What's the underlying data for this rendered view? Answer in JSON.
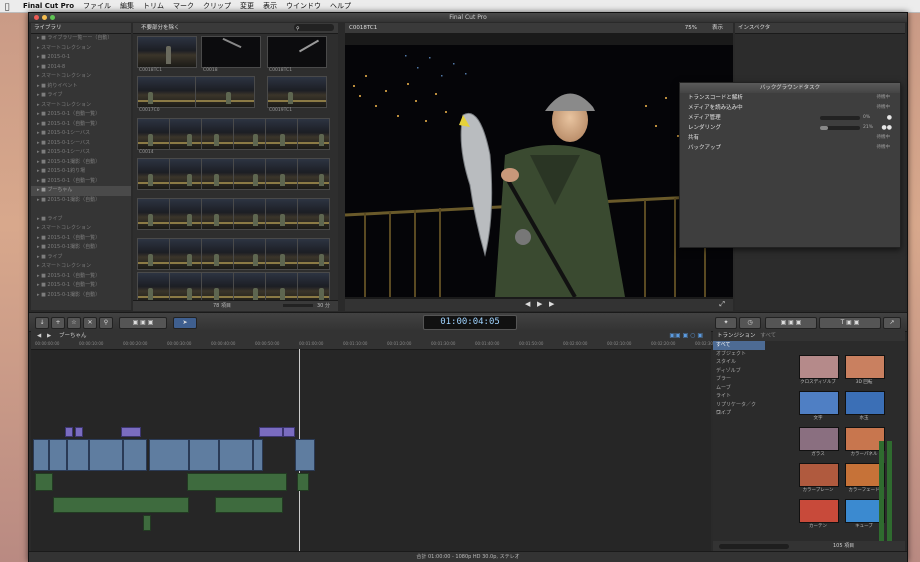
{
  "menubar": {
    "apple": "",
    "app": "Final Cut Pro",
    "items": [
      "ファイル",
      "編集",
      "トリム",
      "マーク",
      "クリップ",
      "変更",
      "表示",
      "ウインドウ",
      "ヘルプ"
    ]
  },
  "window": {
    "title": "Final Cut Pro"
  },
  "library": {
    "header": "ライブラリ",
    "rows": [
      "▸ ■ ライブラリ一覧ーー（自動）",
      "  ▸ スマートコレクション",
      "  ▸ ■ 2015-0-1",
      "  ▸ ■ 2014-8",
      "  ▸ スマートコレクション",
      "  ▸ ■ 釣りイベント",
      "▸ ■ ライブ",
      "  ▸ スマートコレクション",
      "  ▸ ■ 2015-0-1（自動一覧）",
      "  ▸ ■ 2015-0-1（自動一覧）",
      "  ▸ ■ 2015-0-1シーバス",
      "  ▸ ■ 2015-0-1シーバス",
      "  ▸ ■ 2015-0-1シーバス",
      "  ▸ ■ 2015-0-1撮影（自動）",
      "  ▸ ■ 2015-0-1釣り場",
      "  ▸ ■ 2015-0-1（自動一覧）",
      "  ▸ ■ ブーちゃん",
      "  ▸ ■ 2015-0-1撮影（自動）",
      "",
      "▸ ■ ライブ",
      "  ▸ スマートコレクション",
      "  ▸ ■ 2015-0-1（自動一覧）",
      "  ▸ ■ 2015-0-1撮影（自動）",
      "▸ ■ ライブ",
      "  ▸ スマートコレクション",
      "  ▸ ■ 2015-0-1（自動一覧）",
      "  ▸ ■ 2015-0-1（自動一覧）",
      "  ▸ ■ 2015-0-1撮影（自動）"
    ]
  },
  "browser": {
    "filter": "不要部分を除く",
    "captions": [
      "C0018TC1",
      "C0018",
      "C0018TC1",
      "C0017C0",
      "C0019TC1",
      "C0014"
    ],
    "footer_count": "78 項目",
    "footer_duration": "30 分"
  },
  "viewer": {
    "clip_name": "C0018TC1",
    "zoom": "75%",
    "view_label": "表示"
  },
  "inspector": {
    "header": "インスペクタ"
  },
  "background_tasks": {
    "title": "バックグラウンドタスク",
    "items": [
      {
        "label": "トランスコードと解析",
        "status": "待機中"
      },
      {
        "label": "メディアを読み込み中",
        "status": "待機中"
      },
      {
        "label": "メディア管理",
        "pct": "0%"
      },
      {
        "label": "レンダリング",
        "pct": "21%"
      },
      {
        "label": "共有",
        "status": "待機中"
      },
      {
        "label": "バックアップ",
        "status": "待機中"
      }
    ],
    "render_progress": 0.21,
    "media_progress": 0.0
  },
  "toolbar": {
    "timecode": "01:00:04:05",
    "project": "ブーちゃん"
  },
  "timeline": {
    "ruler": [
      "00:00:00:00",
      "00:00:10:00",
      "00:00:20:00",
      "00:00:30:00",
      "00:00:40:00",
      "00:00:50:00",
      "00:01:00:00",
      "00:01:10:00",
      "00:01:20:00",
      "00:01:30:00",
      "00:01:40:00",
      "00:01:50:00",
      "00:02:00:00",
      "00:02:10:00",
      "00:02:20:00",
      "00:02:30:00"
    ]
  },
  "transitions": {
    "header": "トランジション",
    "header2": "すべて",
    "categories": [
      "すべて",
      "オブジェクト",
      "スタイル",
      "ディゾルブ",
      "ブラー",
      "ムーブ",
      "ライト",
      "リプリケータ／クロ…",
      "ワイプ"
    ],
    "items": [
      "クロスディゾルブ",
      "3D 回転",
      "文字",
      "水玉"
    ],
    "items2": [
      "ガラス",
      "カラーパネル",
      "カラープレーン",
      "カラーフェード",
      "カーテン",
      "キューブ"
    ],
    "count": "105 項目",
    "colors": [
      "#b58a8a",
      "#c98060",
      "#4f7fc4",
      "#3b6fb6",
      "#8a6f80",
      "#c8764e",
      "#b05a3e",
      "#c67238",
      "#c84a3a",
      "#3b8ad0"
    ]
  },
  "status": {
    "text": "合計 01:00:00 - 1080p HD 30.0p, ステレオ"
  }
}
